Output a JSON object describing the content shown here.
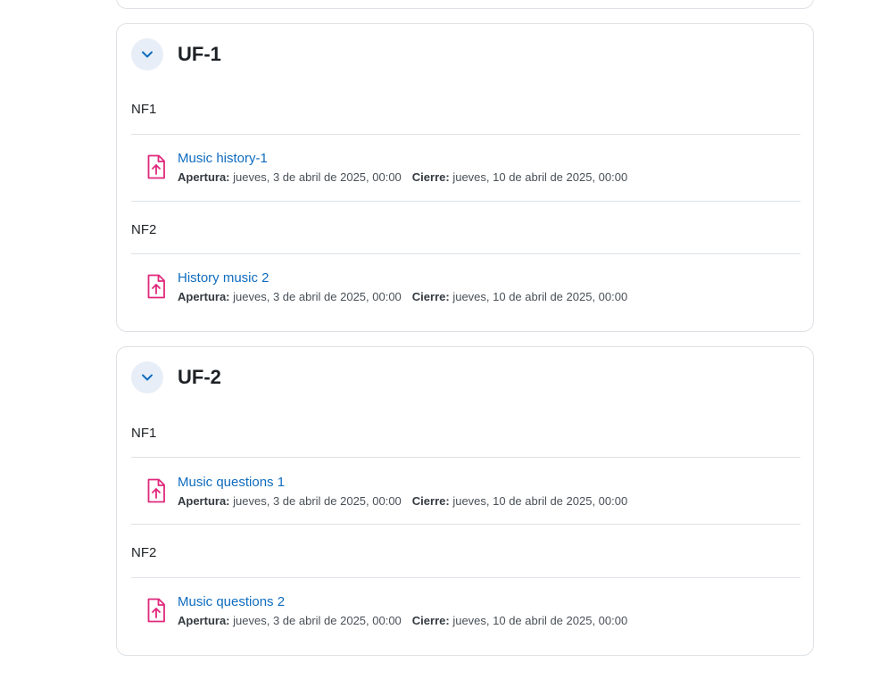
{
  "sections": [
    {
      "title": "UF-1",
      "subsections": [
        {
          "label": "NF1",
          "activities": [
            {
              "name": "Music history-1",
              "open_label": "Apertura:",
              "open_value": "jueves, 3 de abril de 2025, 00:00",
              "close_label": "Cierre:",
              "close_value": "jueves, 10 de abril de 2025, 00:00",
              "icon": "assignment-upload-icon"
            }
          ]
        },
        {
          "label": "NF2",
          "activities": [
            {
              "name": "History music 2",
              "open_label": "Apertura:",
              "open_value": "jueves, 3 de abril de 2025, 00:00",
              "close_label": "Cierre:",
              "close_value": "jueves, 10 de abril de 2025, 00:00",
              "icon": "assignment-upload-icon"
            }
          ]
        }
      ]
    },
    {
      "title": "UF-2",
      "subsections": [
        {
          "label": "NF1",
          "activities": [
            {
              "name": "Music questions 1",
              "open_label": "Apertura:",
              "open_value": "jueves, 3 de abril de 2025, 00:00",
              "close_label": "Cierre:",
              "close_value": "jueves, 10 de abril de 2025, 00:00",
              "icon": "assignment-upload-icon"
            }
          ]
        },
        {
          "label": "NF2",
          "activities": [
            {
              "name": "Music questions 2",
              "open_label": "Apertura:",
              "open_value": "jueves, 3 de abril de 2025, 00:00",
              "close_label": "Cierre:",
              "close_value": "jueves, 10 de abril de 2025, 00:00",
              "icon": "assignment-upload-icon"
            }
          ]
        }
      ]
    }
  ],
  "colors": {
    "link": "#0f6cbf",
    "icon_accent": "#e0287c",
    "collapse_bg": "#e7eef7",
    "border": "#dee2e6"
  }
}
